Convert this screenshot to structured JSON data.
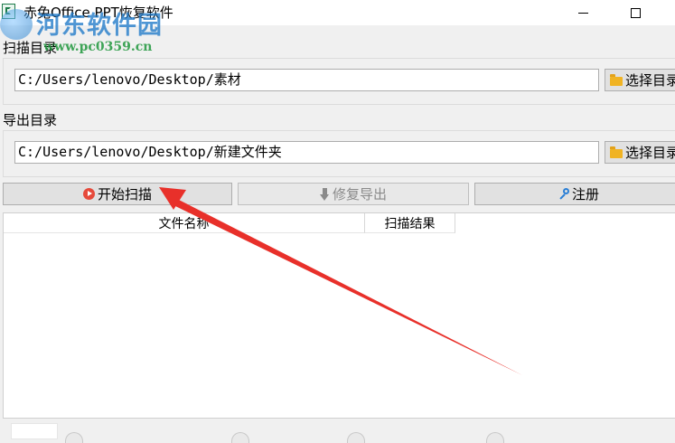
{
  "window": {
    "title": "赤兔Office PPT恢复软件",
    "minimize_icon": "minimize-icon",
    "maximize_icon": "maximize-icon"
  },
  "watermark": {
    "name": "河东软件园",
    "url": "www.pc0359.cn"
  },
  "scan_dir": {
    "label": "扫描目录",
    "value": "C:/Users/lenovo/Desktop/素材",
    "button": "选择目录"
  },
  "export_dir": {
    "label": "导出目录",
    "value": "C:/Users/lenovo/Desktop/新建文件夹",
    "button": "选择目录"
  },
  "actions": {
    "start_scan": "开始扫描",
    "repair_export": "修复导出",
    "register": "注册"
  },
  "table": {
    "columns": [
      "文件名称",
      "扫描结果"
    ],
    "rows": []
  },
  "colors": {
    "annotation_arrow": "#e8302a",
    "play_icon": "#e64a3b",
    "key_icon": "#2a7fd6",
    "folder_icon": "#f0b323"
  }
}
